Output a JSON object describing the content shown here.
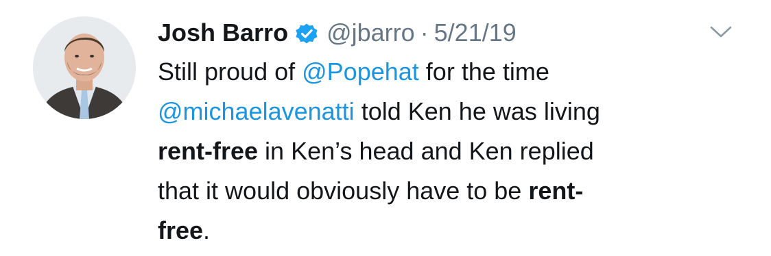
{
  "tweet": {
    "display_name": "Josh Barro",
    "handle": "@jbarro",
    "separator": "·",
    "date": "5/21/19",
    "verified": true,
    "body_lines": [
      [
        {
          "text": "Still proud of ",
          "style": "plain"
        },
        {
          "text": "@Popehat",
          "style": "mention"
        },
        {
          "text": " for the time",
          "style": "plain"
        }
      ],
      [
        {
          "text": "@michaelavenatti",
          "style": "mention"
        },
        {
          "text": " told Ken he was living",
          "style": "plain"
        }
      ],
      [
        {
          "text": "rent-free",
          "style": "bold"
        },
        {
          "text": " in Ken’s head and Ken replied",
          "style": "plain"
        }
      ],
      [
        {
          "text": "that it would obviously have to be ",
          "style": "plain"
        },
        {
          "text": "rent-",
          "style": "bold"
        }
      ],
      [
        {
          "text": "free",
          "style": "bold"
        },
        {
          "text": ".",
          "style": "plain"
        }
      ]
    ]
  },
  "icons": {
    "verified": "verified-badge-icon",
    "more": "chevron-down-icon",
    "avatar": "user-avatar"
  },
  "colors": {
    "mention": "#1b95e0",
    "verified": "#1da1f2",
    "meta": "#657786",
    "text": "#14171a"
  }
}
